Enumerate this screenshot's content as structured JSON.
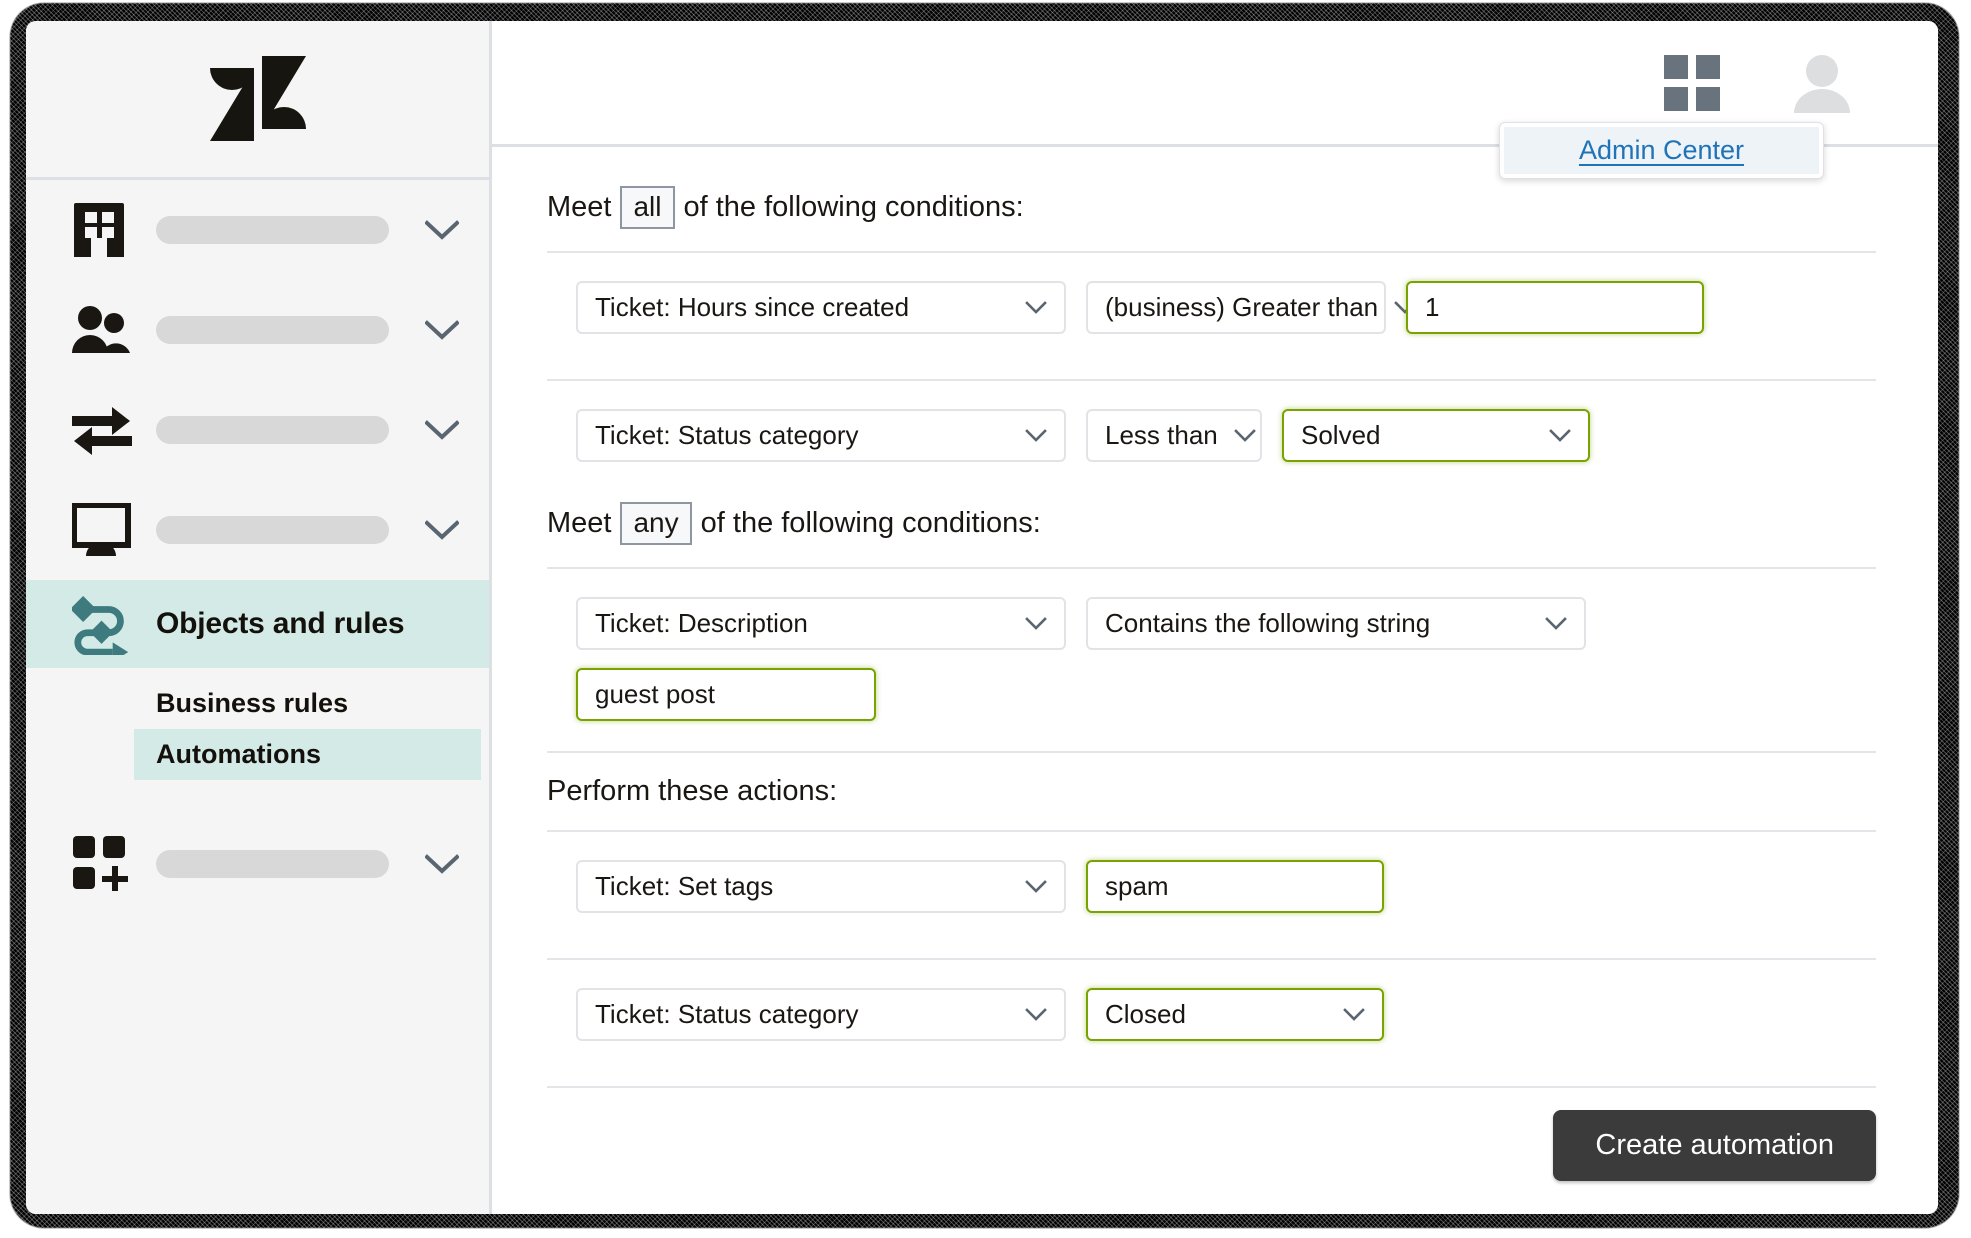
{
  "brand": {
    "logo_icon": "zendesk-logo-icon",
    "accent_teal": "#3d7b7f",
    "highlight_green": "#78a300",
    "link_blue": "#1f73b7",
    "active_bg": "#d4eae7"
  },
  "sidebar": {
    "items": [
      {
        "icon": "building-icon",
        "label": "",
        "placeholder": true,
        "chevron": "chevron-down-icon"
      },
      {
        "icon": "people-icon",
        "label": "",
        "placeholder": true,
        "chevron": "chevron-down-icon"
      },
      {
        "icon": "transfer-arrows-icon",
        "label": "",
        "placeholder": true,
        "chevron": "chevron-down-icon"
      },
      {
        "icon": "monitor-icon",
        "label": "",
        "placeholder": true,
        "chevron": "chevron-down-icon"
      },
      {
        "icon": "objects-rules-icon",
        "label": "Objects and rules",
        "placeholder": false,
        "active": true
      },
      {
        "icon": "apps-add-icon",
        "label": "",
        "placeholder": true,
        "chevron": "chevron-down-icon"
      }
    ],
    "sub_items": [
      {
        "label": "Business rules",
        "selected": false
      },
      {
        "label": "Automations",
        "selected": true
      }
    ]
  },
  "topbar": {
    "grid_icon": "products-grid-icon",
    "avatar_icon": "user-avatar-icon",
    "popover": {
      "link_label": "Admin Center"
    }
  },
  "content": {
    "conditions_all": {
      "prefix": "Meet",
      "operator": "all",
      "suffix": "of the following conditions:",
      "rows": [
        {
          "field": "Ticket: Hours since created",
          "operator": "(business) Greater than",
          "value": "1",
          "value_type": "text",
          "value_highlighted": true
        },
        {
          "field": "Ticket: Status category",
          "operator": "Less than",
          "value": "Solved",
          "value_type": "select",
          "value_highlighted": true
        }
      ]
    },
    "conditions_any": {
      "prefix": "Meet",
      "operator": "any",
      "suffix": "of the following conditions:",
      "rows": [
        {
          "field": "Ticket: Description",
          "operator": "Contains the following string",
          "value": "guest post",
          "value_type": "text",
          "value_highlighted": true
        }
      ]
    },
    "actions": {
      "heading": "Perform these actions:",
      "rows": [
        {
          "field": "Ticket: Set tags",
          "value": "spam",
          "value_type": "text",
          "value_highlighted": true
        },
        {
          "field": "Ticket: Status category",
          "value": "Closed",
          "value_type": "select",
          "value_highlighted": true
        }
      ]
    },
    "footer": {
      "submit_label": "Create automation"
    }
  }
}
